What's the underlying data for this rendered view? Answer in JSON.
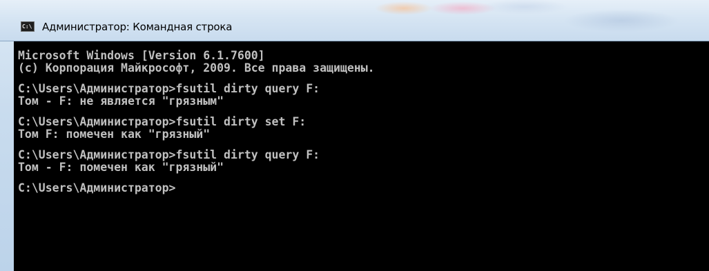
{
  "window": {
    "title": "Администратор: Командная строка",
    "icon": "cmd-console-icon",
    "icon_glyph": "C:\\"
  },
  "console": {
    "lines": [
      "Microsoft Windows [Version 6.1.7600]",
      "(c) Корпорация Майкрософт, 2009. Все права защищены.",
      "",
      "C:\\Users\\Администратор>fsutil dirty query F:",
      "Том - F: не является \"грязным\"",
      "",
      "C:\\Users\\Администратор>fsutil dirty set F:",
      "Том F: помечен как \"грязный\"",
      "",
      "C:\\Users\\Администратор>fsutil dirty query F:",
      "Том - F: помечен как \"грязный\"",
      "",
      "C:\\Users\\Администратор>"
    ]
  },
  "colors": {
    "console_background": "#000000",
    "console_text": "#c0c0c0"
  }
}
